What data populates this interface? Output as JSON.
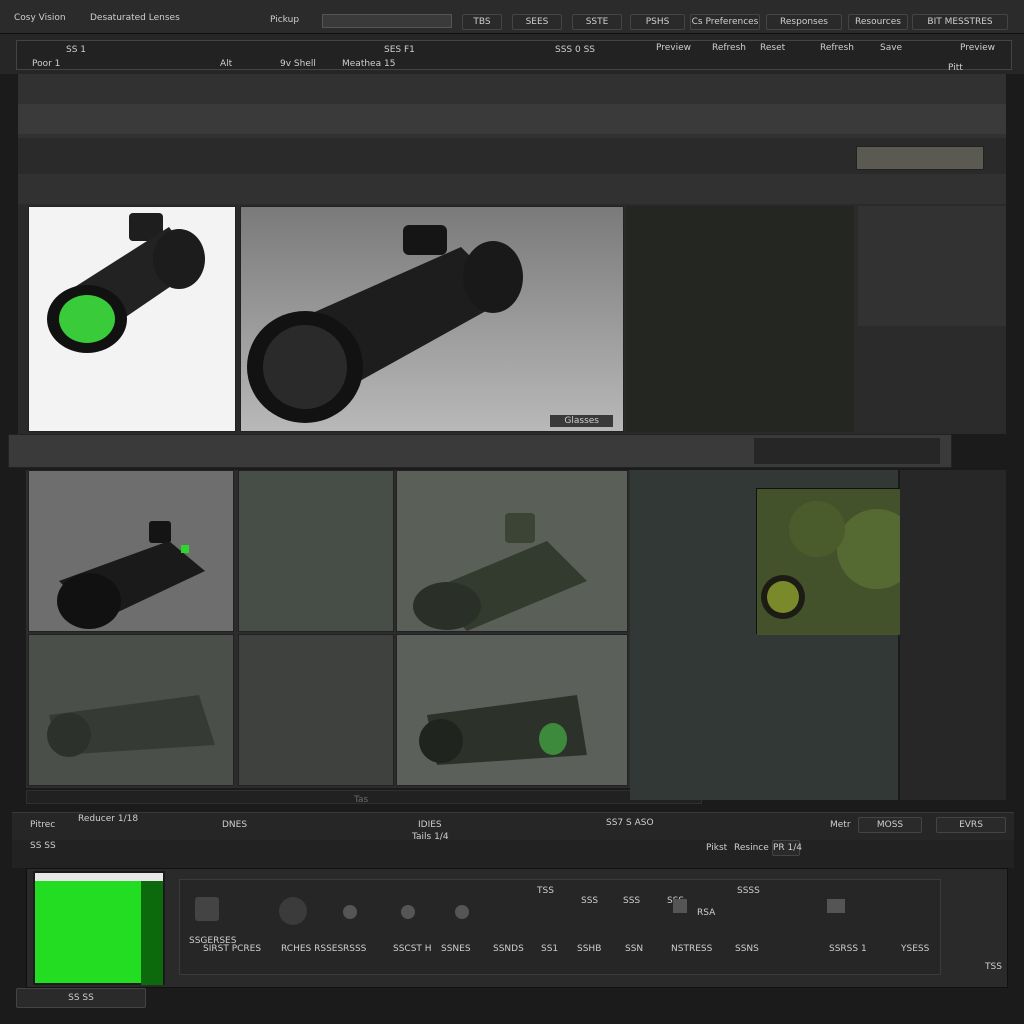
{
  "menu": {
    "left1": "Cosy Vision",
    "left2": "Desaturated Lenses",
    "center": "Pickup",
    "tabs": [
      "TBS",
      "SEES",
      "SSTE",
      "PSHS",
      "Cs Preferences",
      "Responses",
      "Resources",
      "BIT MESSTRES"
    ]
  },
  "toolbar": {
    "row1": [
      "SS 1",
      "SES F1",
      "SSS 0 SS",
      "Preview",
      "Refresh",
      "Reset",
      "Refresh",
      "Save",
      "Preview"
    ],
    "row2": [
      "Poor 1",
      "Alt",
      "9v Shell",
      "Meathea 15",
      "Pitt"
    ]
  },
  "viewer": {
    "preview_caption": "Glasses"
  },
  "gallery": {
    "footer_label": "Tas"
  },
  "status": {
    "left": "Pitrec",
    "left2": "Reducer 1/18",
    "mid1": "DNES",
    "mid2": "IDIES",
    "mid3": "Tails 1/4",
    "right1": "SS7 S ASO",
    "right2": "Metr",
    "mode_label": "MOSS",
    "mode_button": "EVRS"
  },
  "subbar": {
    "left": "SS SS",
    "right1": "Pikst",
    "right2": "Resince",
    "right3": "PR 1/4"
  },
  "bottom": {
    "swatch_color": "#22dd22",
    "row_labels": [
      "SSGERSES",
      "SIRST PCRES",
      "RCHES RSSES",
      "RSSS",
      "SSCST H",
      "SSNES",
      "SSNDS",
      "SS1",
      "SSHB",
      "SSN",
      "NSTRESS",
      "SSNS",
      "SSRSS 1",
      "YSESS"
    ],
    "small_labels": [
      "TSS",
      "SSS",
      "SSS",
      "SSS",
      "RSA",
      "SSSS"
    ],
    "bottom_left": "SS SS",
    "right_small": "TSS"
  },
  "colors": {
    "accent_green": "#2fd52f",
    "panel_bg": "#2f2f2f",
    "window_bg": "#1b1b1b"
  }
}
